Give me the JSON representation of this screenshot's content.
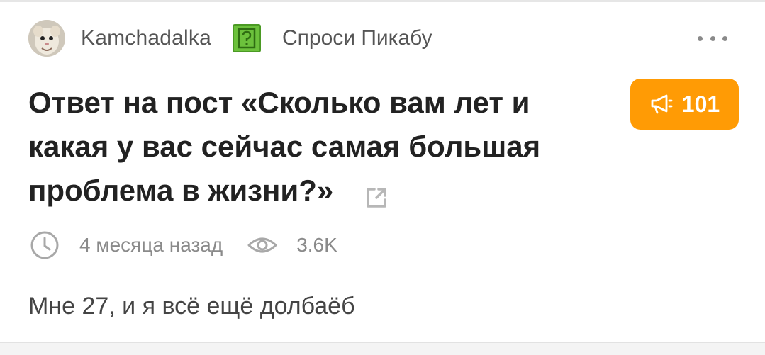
{
  "post": {
    "author": "Kamchadalka",
    "community": "Спроси Пикабу",
    "title": "Ответ на пост «Сколько вам лет и какая у вас сейчас самая большая проблема в жизни?»",
    "rating": "101",
    "time": "4 месяца назад",
    "views": "3.6K",
    "body": "Мне 27, и я всё ещё долбаёб"
  },
  "icons": {
    "avatar": "avatar-image",
    "community": "question-icon",
    "more": "more-icon",
    "share": "share-icon",
    "rating": "megaphone-icon",
    "time": "clock-icon",
    "views": "eye-icon"
  },
  "colors": {
    "rating_bg": "#ff9b05",
    "community_icon": "#6cc13c",
    "muted_text": "#8a8a8a",
    "title_text": "#222222"
  }
}
